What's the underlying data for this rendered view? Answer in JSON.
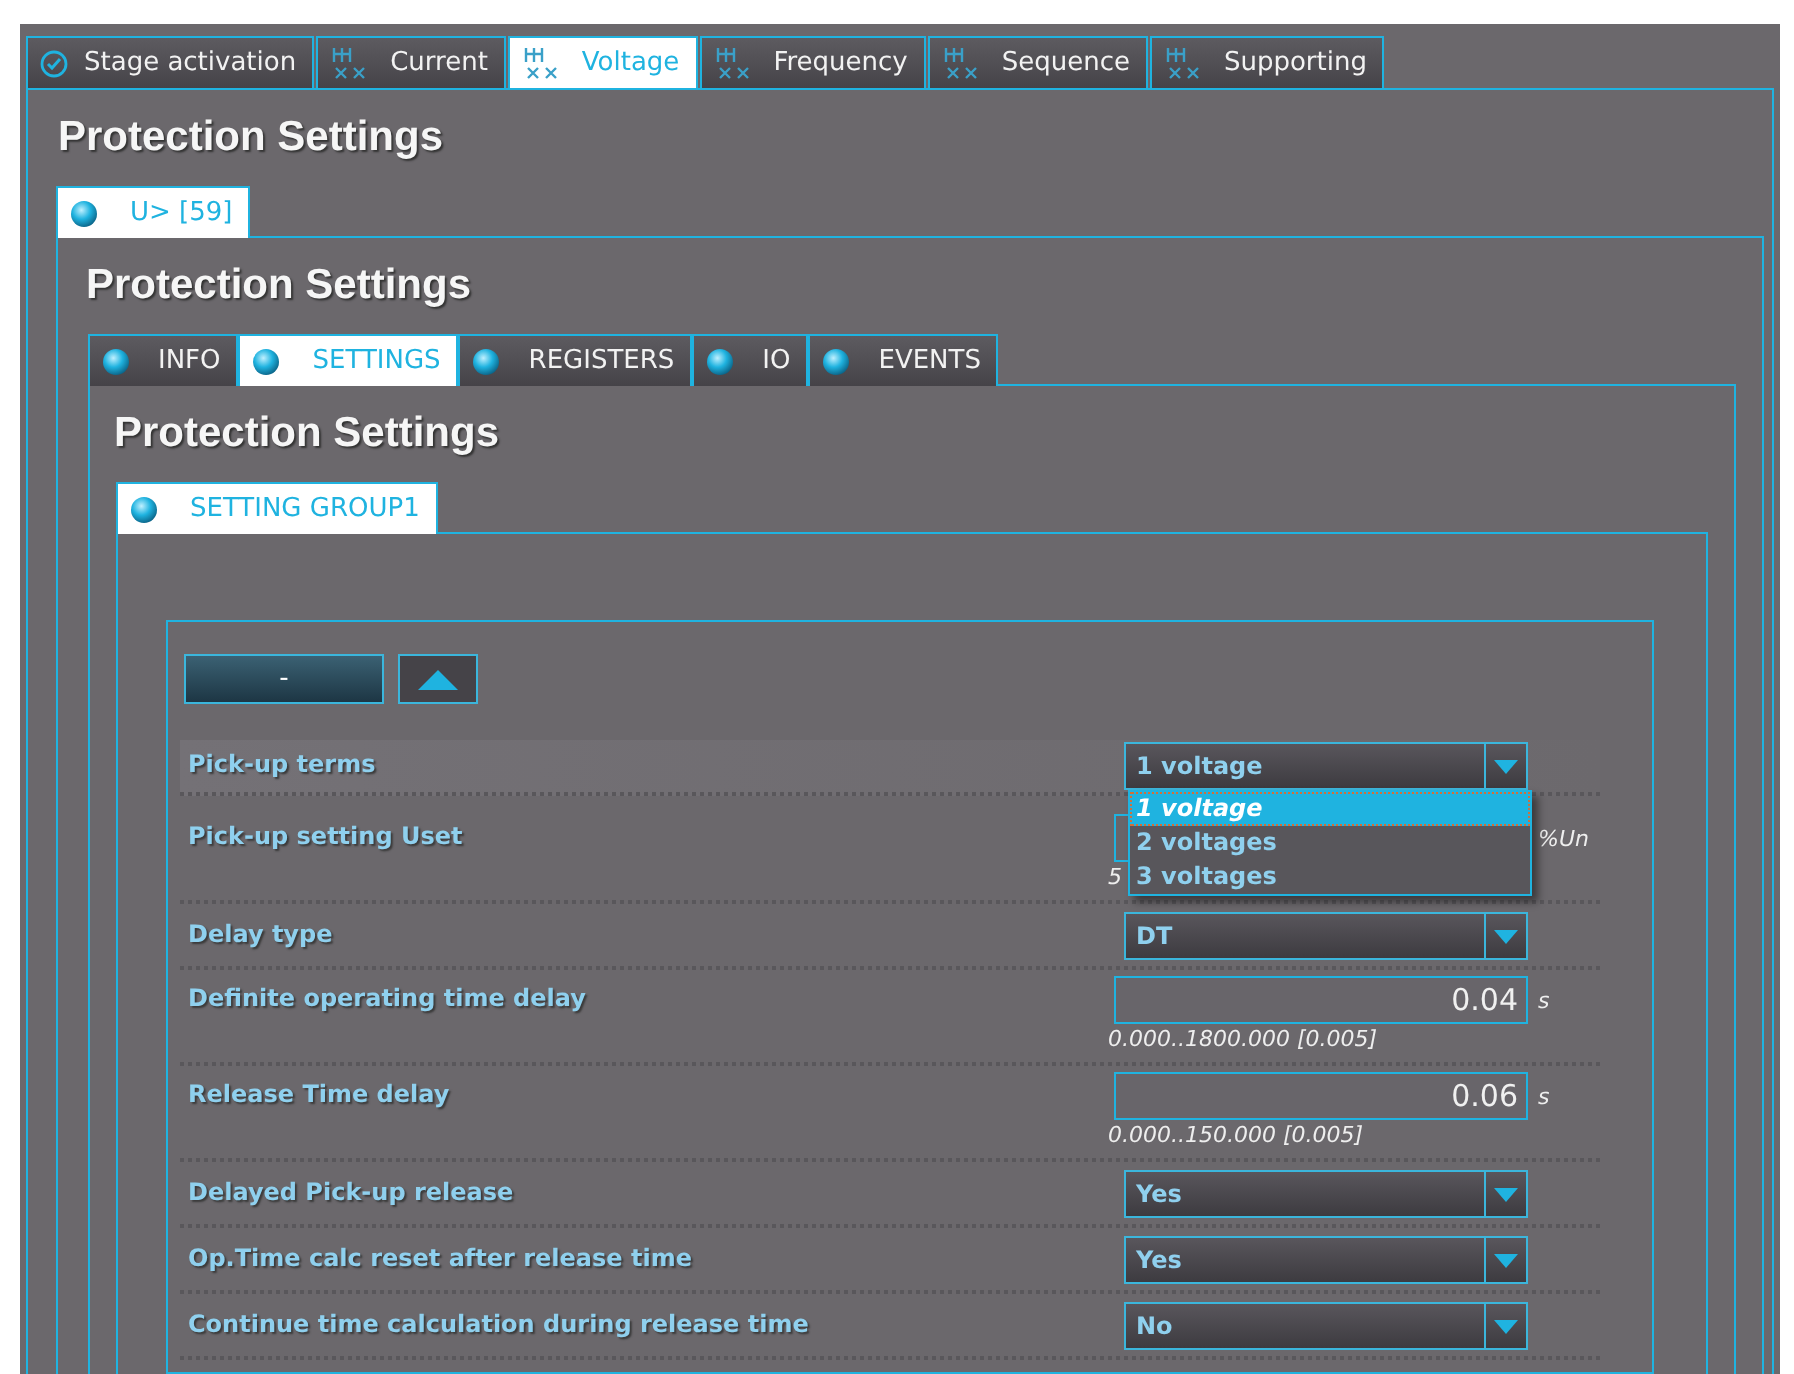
{
  "top_tabs": [
    {
      "label": "Stage activation",
      "selected": false
    },
    {
      "label": "Current",
      "selected": false
    },
    {
      "label": "Voltage",
      "selected": true
    },
    {
      "label": "Frequency",
      "selected": false
    },
    {
      "label": "Sequence",
      "selected": false
    },
    {
      "label": "Supporting",
      "selected": false
    }
  ],
  "panel": {
    "title": "Protection Settings",
    "tabs": [
      {
        "label": "U> [59]",
        "selected": true
      }
    ],
    "panel": {
      "title": "Protection Settings",
      "tabs": [
        {
          "label": "INFO",
          "selected": false
        },
        {
          "label": "SETTINGS",
          "selected": true
        },
        {
          "label": "REGISTERS",
          "selected": false
        },
        {
          "label": "IO",
          "selected": false
        },
        {
          "label": "EVENTS",
          "selected": false
        }
      ],
      "panel": {
        "title": "Protection Settings",
        "tabs": [
          {
            "label": "SETTING GROUP1",
            "selected": true
          }
        ],
        "group": {
          "button": "-",
          "rows": [
            {
              "kind": "select",
              "label": "Pick-up terms",
              "value": "1 voltage",
              "highlighted": true,
              "expanded": true,
              "options": [
                {
                  "label": "1 voltage",
                  "selected": true
                },
                {
                  "label": "2 voltages",
                  "selected": false
                },
                {
                  "label": "3 voltages",
                  "selected": false
                }
              ]
            },
            {
              "kind": "number",
              "label": "Pick-up setting Uset",
              "unit": "%Un",
              "range": "5"
            },
            {
              "kind": "select",
              "label": "Delay type",
              "value": "DT"
            },
            {
              "kind": "number",
              "label": "Definite operating time delay",
              "value": "0.04",
              "unit": "s",
              "range": "0.000..1800.000 [0.005]"
            },
            {
              "kind": "number",
              "label": "Release Time delay",
              "value": "0.06",
              "unit": "s",
              "range": "0.000..150.000 [0.005]"
            },
            {
              "kind": "select",
              "label": "Delayed Pick-up release",
              "value": "Yes"
            },
            {
              "kind": "select",
              "label": "Op.Time calc reset after release time",
              "value": "Yes"
            },
            {
              "kind": "select",
              "label": "Continue time calculation during release time",
              "value": "No"
            }
          ]
        }
      }
    }
  }
}
